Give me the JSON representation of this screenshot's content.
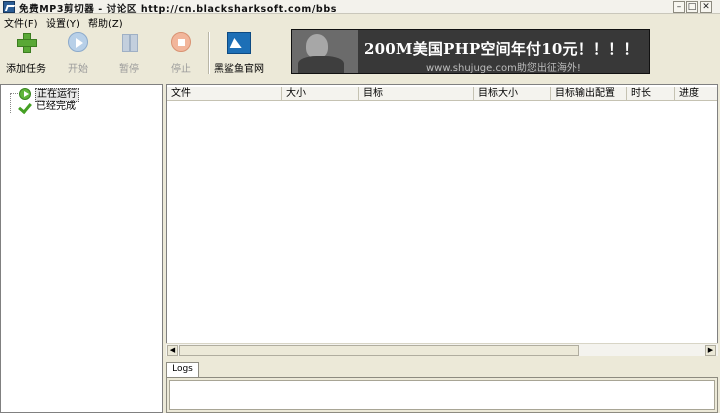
{
  "window": {
    "title": "免费MP3剪切器 - 讨论区 http://cn.blacksharksoft.com/bbs",
    "min_glyph": "–",
    "max_glyph": "□",
    "close_glyph": "✕"
  },
  "menu": {
    "items": [
      "文件(F)",
      "设置(Y)",
      "帮助(Z)"
    ]
  },
  "toolbar": {
    "add_task": "添加任务",
    "start": "开始",
    "pause": "暂停",
    "stop": "停止",
    "website": "黑鲨鱼官网"
  },
  "banner": {
    "headline": "200M美国PHP空间年付10元！！！！",
    "subtext": "www.shujuge.com助您出征海外!"
  },
  "tree": {
    "items": [
      {
        "label": "正在运行",
        "icon": "running-icon",
        "selected": true
      },
      {
        "label": "已经完成",
        "icon": "check-icon",
        "selected": false
      }
    ]
  },
  "table": {
    "columns": [
      "文件",
      "大小",
      "目标",
      "目标大小",
      "目标输出配置",
      "时长",
      "进度"
    ],
    "rows": []
  },
  "scrollbar": {
    "left_glyph": "◀",
    "right_glyph": "▶"
  },
  "logs": {
    "tab_label": "Logs",
    "content": ""
  }
}
